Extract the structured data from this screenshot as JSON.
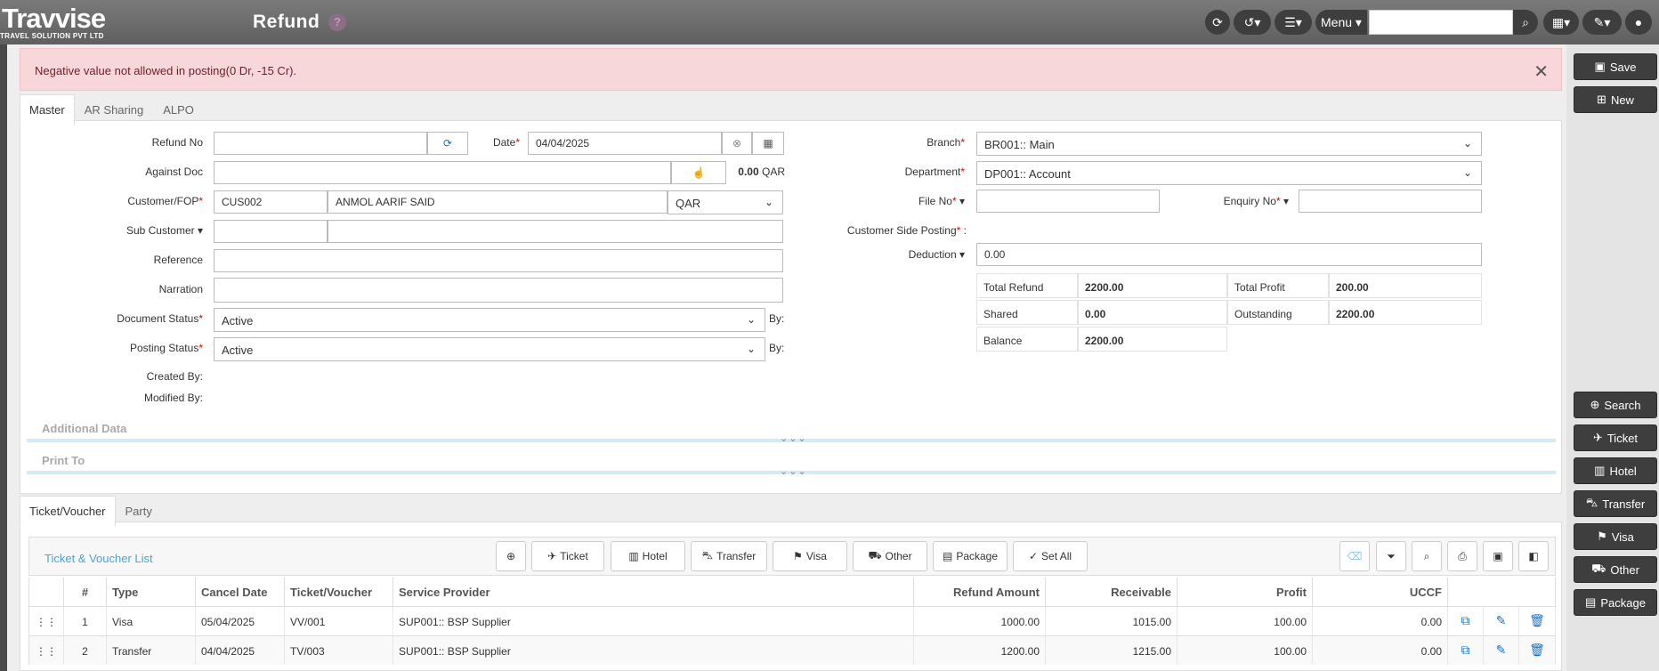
{
  "header": {
    "logo": "Travvise",
    "logo_sub": "TRAVEL SOLUTION PVT LTD",
    "title": "Refund",
    "help": "?",
    "menu_label": "Menu"
  },
  "alert": {
    "message": "Negative value not allowed in posting(0 Dr, -15 Cr)."
  },
  "side_buttons": {
    "save": "Save",
    "new": "New",
    "search": "Search",
    "ticket": "Ticket",
    "hotel": "Hotel",
    "transfer": "Transfer",
    "visa": "Visa",
    "other": "Other",
    "package": "Package"
  },
  "tabs": {
    "master": "Master",
    "ar_sharing": "AR Sharing",
    "alpo": "ALPO"
  },
  "form": {
    "refund_no_label": "Refund No",
    "date_label": "Date",
    "date_value": "04/04/2025",
    "against_doc_label": "Against Doc",
    "against_amount": "0.00",
    "against_currency": "QAR",
    "customer_label": "Customer/FOP",
    "customer_code": "CUS002",
    "customer_name": "ANMOL AARIF SAID",
    "customer_currency": "QAR",
    "sub_customer_label": "Sub Customer",
    "reference_label": "Reference",
    "narration_label": "Narration",
    "document_status_label": "Document Status",
    "document_status": "Active",
    "posting_status_label": "Posting Status",
    "posting_status": "Active",
    "by_label": "By:",
    "created_by_label": "Created By:",
    "modified_by_label": "Modified By:",
    "branch_label": "Branch",
    "branch_value": "BR001:: Main",
    "department_label": "Department",
    "department_value": "DP001:: Account",
    "file_no_label": "File No",
    "enquiry_no_label": "Enquiry No",
    "customer_side_posting_label": "Customer Side Posting",
    "deduction_label": "Deduction",
    "deduction_value": "0.00"
  },
  "summary": {
    "total_refund_label": "Total Refund",
    "total_refund": "2200.00",
    "total_profit_label": "Total Profit",
    "total_profit": "200.00",
    "shared_label": "Shared",
    "shared": "0.00",
    "outstanding_label": "Outstanding",
    "outstanding": "2200.00",
    "balance_label": "Balance",
    "balance": "2200.00"
  },
  "sections": {
    "additional": "Additional Data",
    "print_to": "Print To",
    "arrows": "⌄⌄⌄"
  },
  "lower_tabs": {
    "ticket_voucher": "Ticket/Voucher",
    "party": "Party"
  },
  "list": {
    "title": "Ticket & Voucher List",
    "btn_ticket": "Ticket",
    "btn_hotel": "Hotel",
    "btn_transfer": "Transfer",
    "btn_visa": "Visa",
    "btn_other": "Other",
    "btn_package": "Package",
    "btn_set_all": "Set All",
    "columns": [
      "#",
      "Type",
      "Cancel Date",
      "Ticket/Voucher",
      "Service Provider",
      "Refund Amount",
      "Receivable",
      "Profit",
      "UCCF"
    ],
    "rows": [
      {
        "no": "1",
        "type": "Visa",
        "cancel_date": "05/04/2025",
        "voucher": "VV/001",
        "provider": "SUP001:: BSP Supplier",
        "refund": "1000.00",
        "receivable": "1015.00",
        "profit": "100.00",
        "uccf": "0.00"
      },
      {
        "no": "2",
        "type": "Transfer",
        "cancel_date": "04/04/2025",
        "voucher": "TV/003",
        "provider": "SUP001:: BSP Supplier",
        "refund": "1200.00",
        "receivable": "1215.00",
        "profit": "100.00",
        "uccf": "0.00"
      }
    ]
  }
}
